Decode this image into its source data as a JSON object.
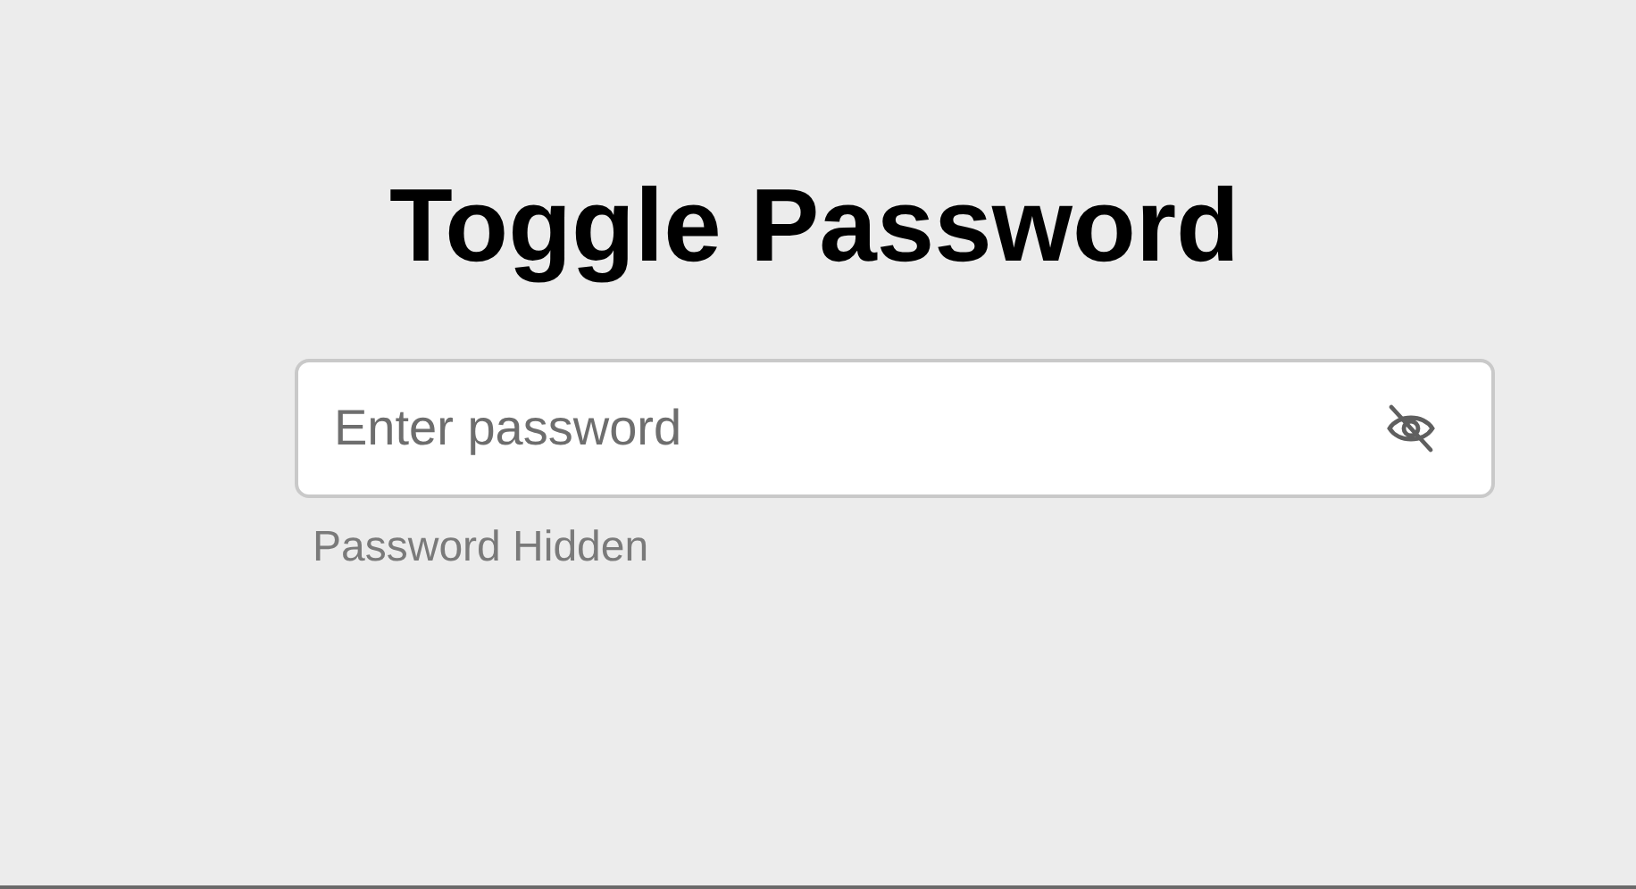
{
  "title": "Toggle Password",
  "password_field": {
    "placeholder": "Enter password",
    "visible": false
  },
  "status": "Password Hidden"
}
